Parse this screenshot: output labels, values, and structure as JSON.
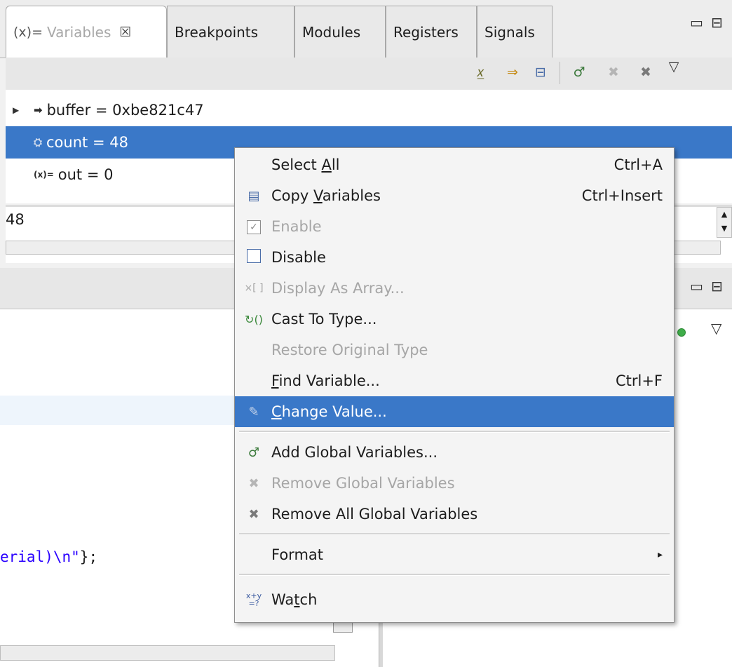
{
  "tabs": {
    "variables": {
      "icon_text": "(x)=",
      "label": "Variables",
      "close": "☒"
    },
    "breakpoints": "Breakpoints",
    "modules": "Modules",
    "registers": "Registers",
    "signals": "Signals"
  },
  "window_controls": {
    "minimize": "▭",
    "maximize": "⊟"
  },
  "toolbar": {
    "icons": [
      "show-type-names-icon",
      "show-logical-structure-icon",
      "collapse-all-icon",
      "add-global-variables-icon",
      "remove-global-variables-icon",
      "remove-all-global-variables-icon",
      "view-menu-icon"
    ],
    "view_menu_glyph": "▽"
  },
  "variables": [
    {
      "name_value": "buffer = 0xbe821c47",
      "icon": "➡",
      "expandable": true,
      "selected": false
    },
    {
      "name_value": "count = 48",
      "icon": "⛭",
      "expandable": false,
      "selected": true
    },
    {
      "name_value": "out = 0",
      "icon": "(x)=",
      "expandable": false,
      "selected": false
    }
  ],
  "detail": {
    "value": "48"
  },
  "editor": {
    "code_fragment": "erial)\\n\"",
    "code_tail": "};"
  },
  "context_menu": {
    "select_all": {
      "label_pre": "Select ",
      "label_u": "A",
      "label_post": "ll",
      "accel": "Ctrl+A"
    },
    "copy_variables": {
      "label_pre": "Copy ",
      "label_u": "V",
      "label_post": "ariables",
      "accel": "Ctrl+Insert"
    },
    "enable": {
      "label": "Enable"
    },
    "disable": {
      "label": "Disable"
    },
    "display_as_array": {
      "icon": "×[ ]",
      "label": "Display As Array..."
    },
    "cast_to_type": {
      "label": "Cast To Type..."
    },
    "restore_original_type": {
      "label": "Restore Original Type"
    },
    "find_variable": {
      "label_u": "F",
      "label_post": "ind Variable...",
      "accel": "Ctrl+F"
    },
    "change_value": {
      "label_u": "C",
      "label_post": "hange Value..."
    },
    "add_global_variables": {
      "label": "Add Global Variables..."
    },
    "remove_global_variables": {
      "label": "Remove Global Variables"
    },
    "remove_all_global_variables": {
      "label": "Remove All Global Variables"
    },
    "format": {
      "label": "Format",
      "submenu_arrow": "▸"
    },
    "watch": {
      "icon": "x+y =?",
      "label_pre": "Wa",
      "label_u": "t",
      "label_post": "ch"
    }
  },
  "colors": {
    "selection": "#3a78c8",
    "string_literal": "#2a00ff"
  }
}
